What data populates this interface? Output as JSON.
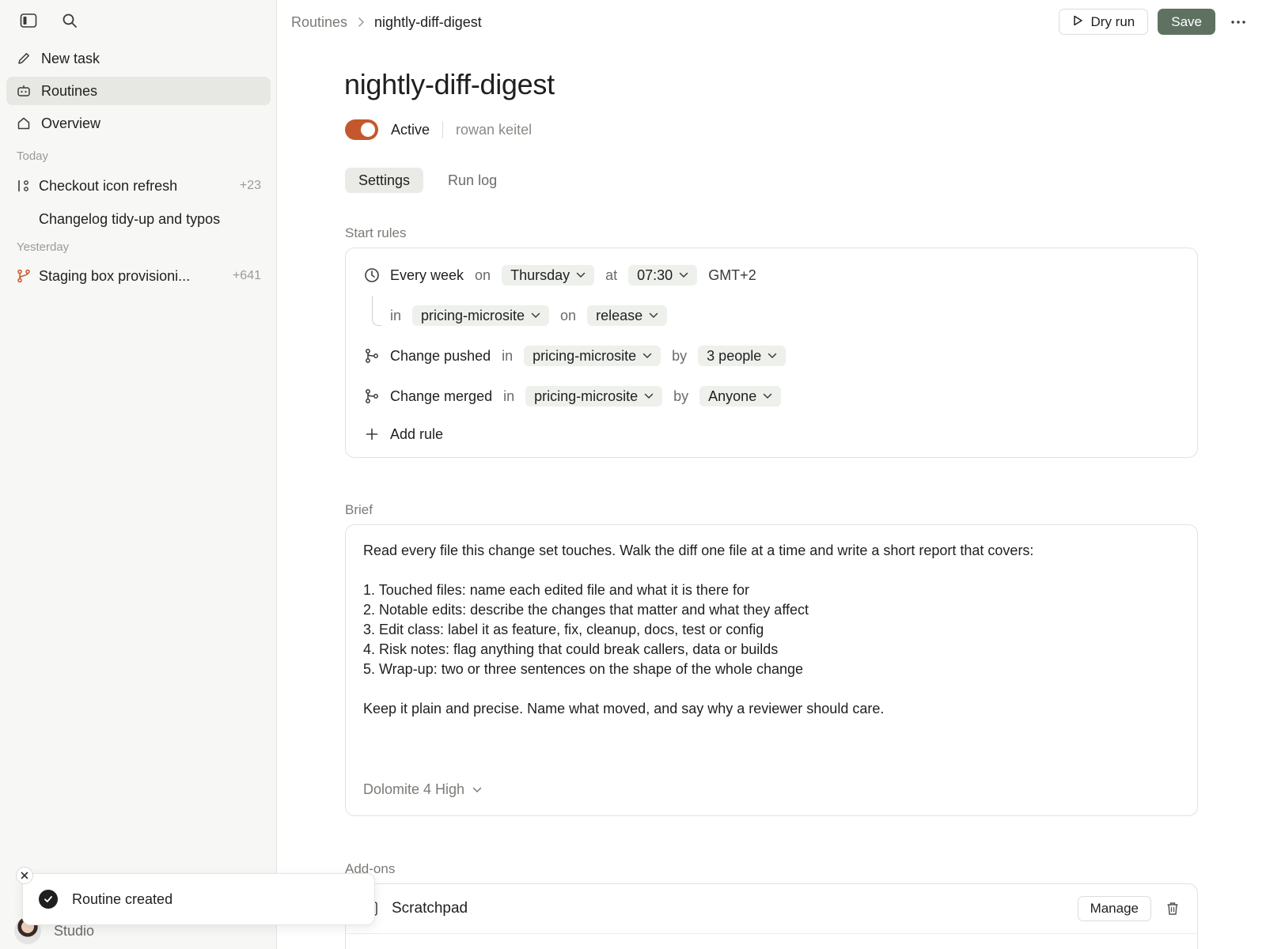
{
  "sidebar": {
    "nav": [
      {
        "label": "New task",
        "icon": "pencil-icon"
      },
      {
        "label": "Routines",
        "icon": "robot-icon"
      },
      {
        "label": "Overview",
        "icon": "home-icon"
      }
    ],
    "sections": [
      {
        "label": "Today"
      },
      {
        "label": "Yesterday"
      }
    ],
    "tasks": [
      {
        "label": "Checkout icon refresh",
        "count": "+23"
      },
      {
        "label": "Changelog tidy-up and typos"
      },
      {
        "label": "Staging box provisioni...",
        "count": "+641"
      }
    ],
    "workspace": "Studio"
  },
  "toast": {
    "message": "Routine created"
  },
  "header": {
    "breadcrumb_parent": "Routines",
    "breadcrumb_current": "nightly-diff-digest",
    "dry_run": "Dry run",
    "save": "Save"
  },
  "routine": {
    "title": "nightly-diff-digest",
    "status": "Active",
    "owner": "rowan keitel",
    "active": true
  },
  "tabs": [
    {
      "label": "Settings",
      "active": true
    },
    {
      "label": "Run log",
      "active": false
    }
  ],
  "start_rules": {
    "label": "Start rules",
    "schedule": {
      "frequency": "Every week",
      "on_kw": "on",
      "day": "Thursday",
      "at_kw": "at",
      "time": "07:30",
      "tz": "GMT+2",
      "in_kw": "in",
      "repo": "pricing-microsite",
      "on_kw2": "on",
      "branch": "release"
    },
    "pushed": {
      "event": "Change pushed",
      "in_kw": "in",
      "repo": "pricing-microsite",
      "by_kw": "by",
      "who": "3 people"
    },
    "merged": {
      "event": "Change merged",
      "in_kw": "in",
      "repo": "pricing-microsite",
      "by_kw": "by",
      "who": "Anyone"
    },
    "add_rule": "Add rule"
  },
  "brief": {
    "label": "Brief",
    "intro": "Read every file this change set touches. Walk the diff one file at a time and write a short report that covers:",
    "items": [
      "1. Touched files: name each edited file and what it is there for",
      "2. Notable edits: describe the changes that matter and what they affect",
      "3. Edit class: label it as feature, fix, cleanup, docs, test or config",
      "4. Risk notes: flag anything that could break callers, data or builds",
      "5. Wrap-up: two or three sentences on the shape of the whole change"
    ],
    "outro": "Keep it plain and precise. Name what moved, and say why a reviewer should care.",
    "model": "Dolomite 4 High"
  },
  "addons": {
    "label": "Add-ons",
    "items": [
      {
        "name": "Scratchpad",
        "manage": "Manage"
      }
    ]
  },
  "colors": {
    "accent": "#c4582c",
    "save": "#5f7262"
  }
}
